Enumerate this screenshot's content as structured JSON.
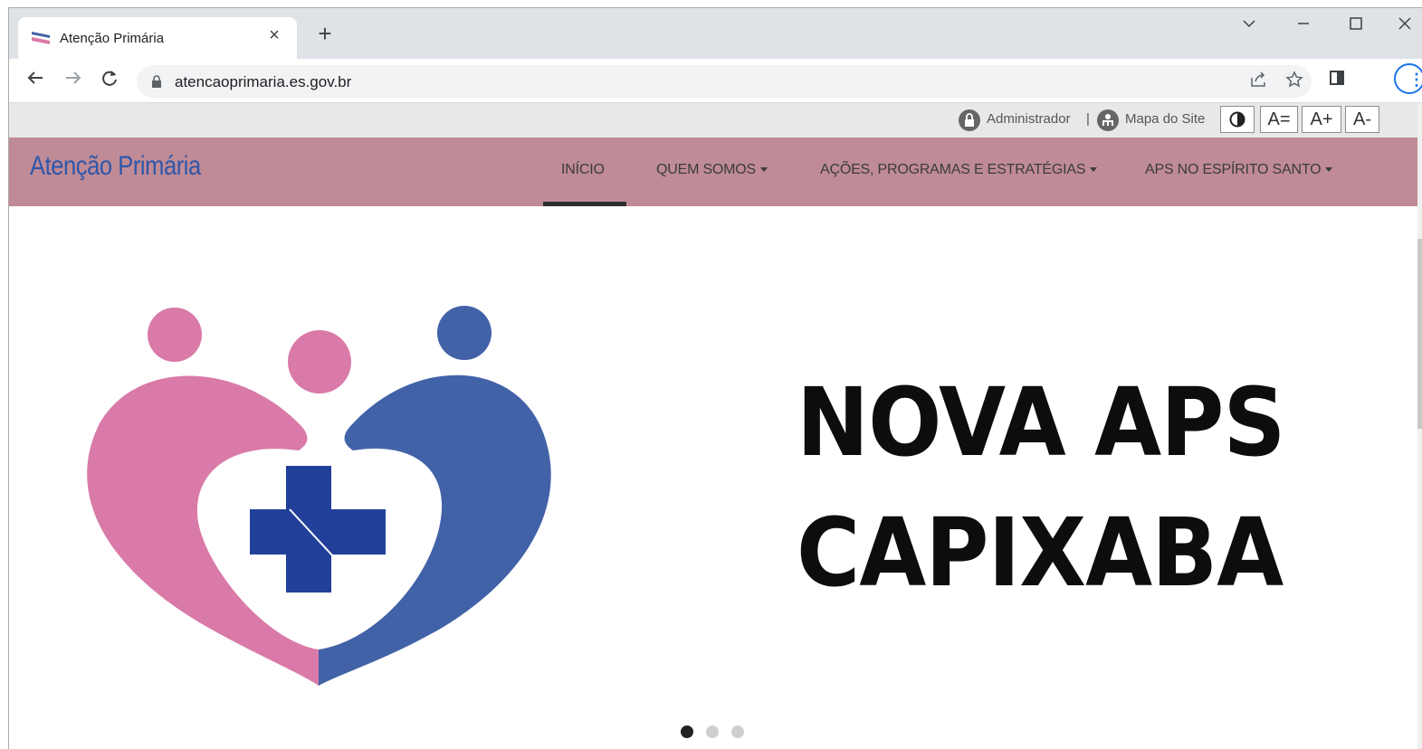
{
  "browser": {
    "tab_title": "Atenção Primária",
    "tab_close": "×",
    "new_tab": "+",
    "url": "atencaoprimaria.es.gov.br",
    "window_controls": [
      "chevron-down-icon",
      "minimize-icon",
      "maximize-icon",
      "close-icon"
    ]
  },
  "utility": {
    "admin_label": "Administrador",
    "separator": "|",
    "sitemap_label": "Mapa do Site",
    "font_normal": "A=",
    "font_increase": "A+",
    "font_decrease": "A-"
  },
  "site": {
    "brand": "Atenção Primária",
    "nav": {
      "inicio": "INÍCIO",
      "quem_somos": "QUEM SOMOS",
      "acoes": "AÇÕES, PROGRAMAS E ESTRATÉGIAS",
      "aps_es": "APS NO ESPÍRITO SANTO"
    },
    "active_nav": "INÍCIO"
  },
  "hero": {
    "line1": "NOVA APS",
    "line2": "CAPIXABA",
    "slide_count": 3,
    "active_slide": 1
  },
  "colors": {
    "navbar": "#bf8b97",
    "brand": "#2f56a8",
    "logo_pink": "#d97aa8",
    "logo_blue": "#4262a8",
    "cross_blue": "#22409a"
  }
}
